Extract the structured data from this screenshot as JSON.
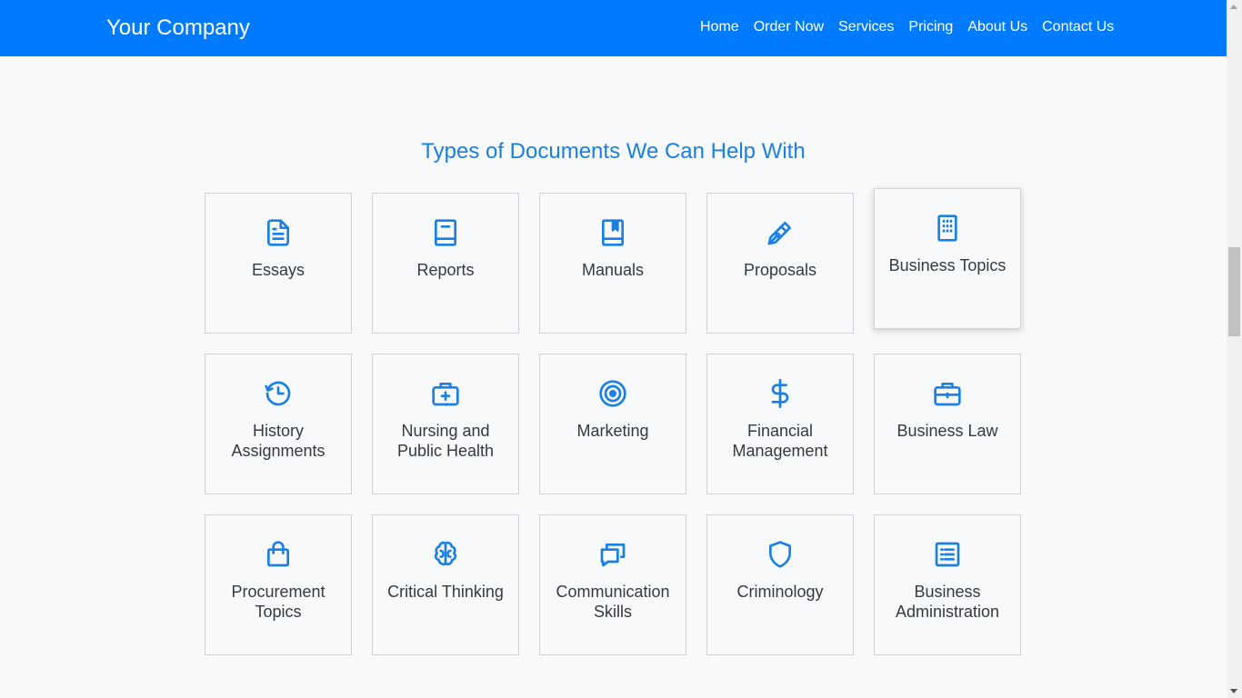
{
  "navbar": {
    "brand": "Your Company",
    "links": [
      "Home",
      "Order Now",
      "Services",
      "Pricing",
      "About Us",
      "Contact Us"
    ],
    "background": "#007bff"
  },
  "section": {
    "title": "Types of Documents We Can Help With",
    "accent_color": "#1a7fe6"
  },
  "cards": [
    {
      "label": "Essays",
      "icon": "file-text-icon"
    },
    {
      "label": "Reports",
      "icon": "book-icon"
    },
    {
      "label": "Manuals",
      "icon": "bookmark-book-icon"
    },
    {
      "label": "Proposals",
      "icon": "pen-nib-icon"
    },
    {
      "label": "Business Topics",
      "icon": "building-icon"
    },
    {
      "label": "History Assignments",
      "icon": "history-clock-icon"
    },
    {
      "label": "Nursing and Public Health",
      "icon": "medical-kit-icon"
    },
    {
      "label": "Marketing",
      "icon": "target-icon"
    },
    {
      "label": "Financial Management",
      "icon": "dollar-icon"
    },
    {
      "label": "Business Law",
      "icon": "briefcase-icon"
    },
    {
      "label": "Procurement Topics",
      "icon": "shopping-bag-icon"
    },
    {
      "label": "Critical Thinking",
      "icon": "brain-icon"
    },
    {
      "label": "Communication Skills",
      "icon": "chat-bubbles-icon"
    },
    {
      "label": "Criminology",
      "icon": "shield-icon"
    },
    {
      "label": "Business Administration",
      "icon": "list-document-icon"
    }
  ]
}
